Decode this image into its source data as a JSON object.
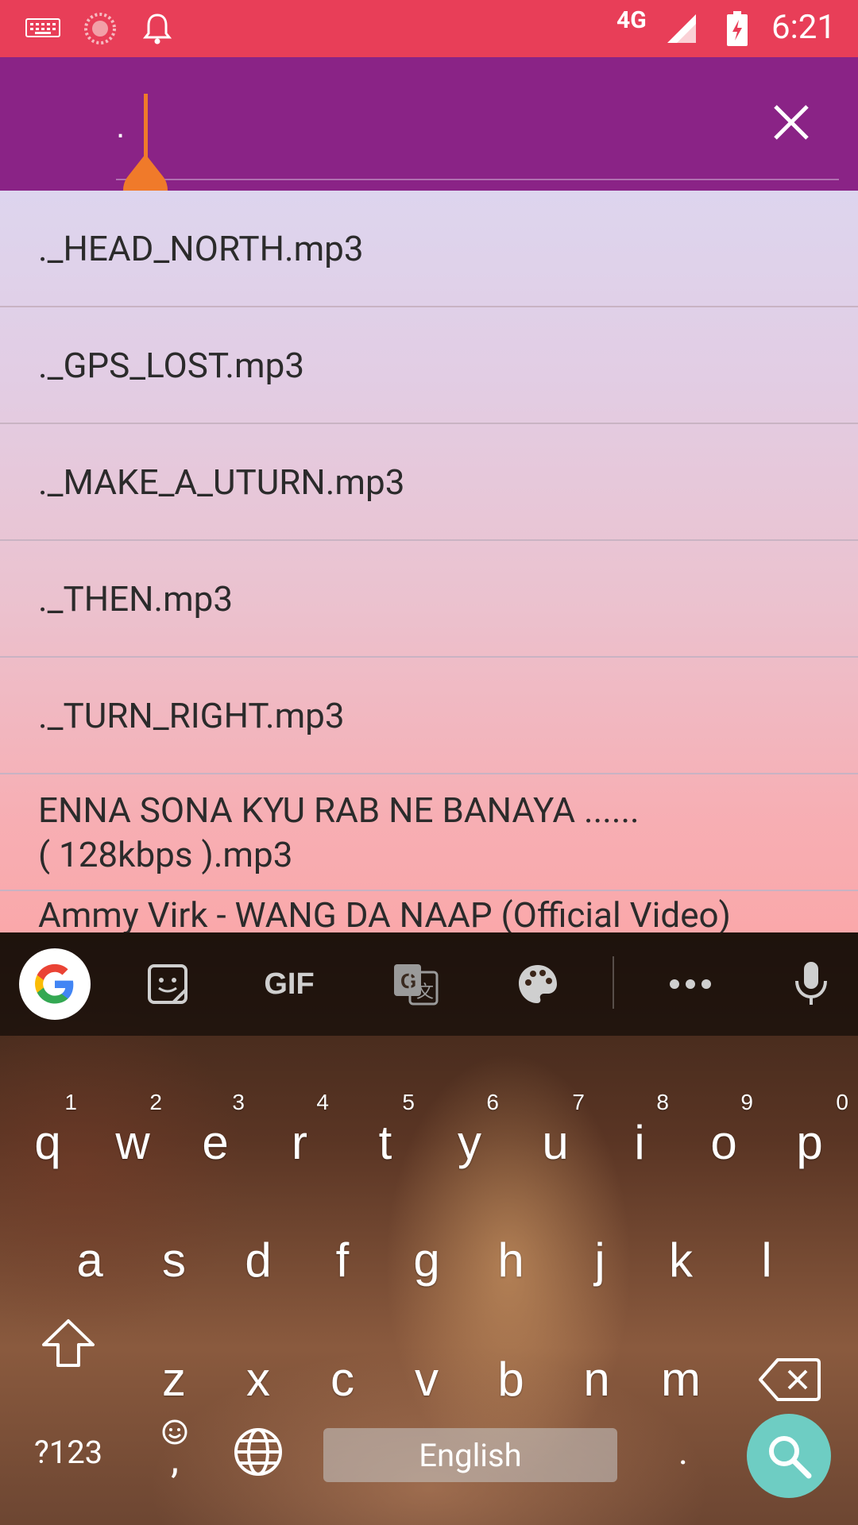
{
  "status_bar": {
    "time": "6:21",
    "network": "4G",
    "icons": [
      "keyboard-icon",
      "sync-icon",
      "notification-bell-icon",
      "signal-icon",
      "battery-charging-icon"
    ],
    "background": "#e83e58"
  },
  "toolbar": {
    "background": "#8a2386",
    "search_value": ".",
    "clear_icon": "close-icon"
  },
  "files": [
    "._HEAD_NORTH.mp3",
    "._GPS_LOST.mp3",
    "._MAKE_A_UTURN.mp3",
    "._THEN.mp3",
    "._TURN_RIGHT.mp3",
    "ENNA SONA KYU RAB NE BANAYA ......\n( 128kbps ).mp3",
    "Ammy Virk  - WANG DA NAAP (Official Video)"
  ],
  "keyboard": {
    "toolbar_icons": [
      "google-icon",
      "sticker-icon",
      "gif-icon",
      "translate-icon",
      "palette-icon",
      "more-icon",
      "mic-icon"
    ],
    "gif_label": "GIF",
    "row1": [
      {
        "key": "q",
        "hint": "1"
      },
      {
        "key": "w",
        "hint": "2"
      },
      {
        "key": "e",
        "hint": "3"
      },
      {
        "key": "r",
        "hint": "4"
      },
      {
        "key": "t",
        "hint": "5"
      },
      {
        "key": "y",
        "hint": "6"
      },
      {
        "key": "u",
        "hint": "7"
      },
      {
        "key": "i",
        "hint": "8"
      },
      {
        "key": "o",
        "hint": "9"
      },
      {
        "key": "p",
        "hint": "0"
      }
    ],
    "row2": [
      "a",
      "s",
      "d",
      "f",
      "g",
      "h",
      "j",
      "k",
      "l"
    ],
    "row3": [
      "z",
      "x",
      "c",
      "v",
      "b",
      "n",
      "m"
    ],
    "symbols_key": "?123",
    "comma_key": ",",
    "space_label": "English",
    "period_key": ".",
    "accent": "#6ecdc3"
  }
}
